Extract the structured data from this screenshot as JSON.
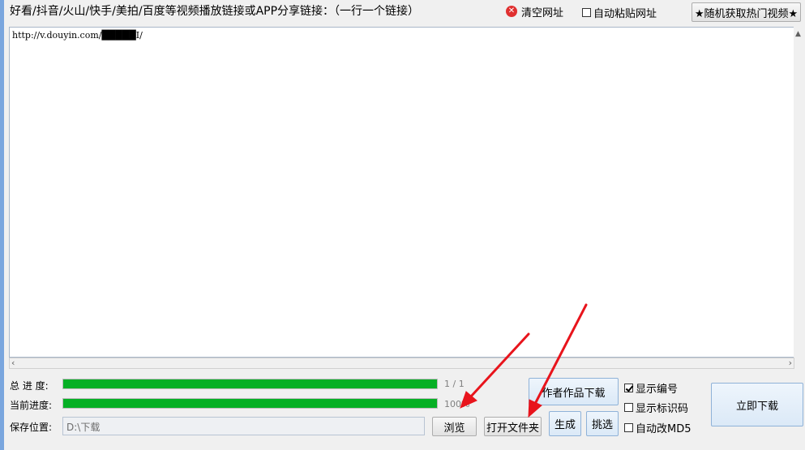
{
  "header": {
    "title": "好看/抖音/火山/快手/美拍/百度等视频播放链接或APP分享链接：（一行一个链接）",
    "clear_label": "清空网址",
    "auto_paste_label": "自动粘贴网址",
    "auto_paste_checked": false,
    "hot_video_label": "★随机获取热门视频★"
  },
  "url_box": {
    "text": "http://v.douyin.com/█████I/"
  },
  "progress": {
    "total_label": "总 进 度:",
    "total_value": "1 / 1",
    "total_fraction": 1.0,
    "current_label": "当前进度:",
    "current_value": "100%",
    "current_fraction": 1.0
  },
  "save": {
    "label": "保存位置:",
    "path": "D:\\下载",
    "browse_label": "浏览",
    "open_folder_label": "打开文件夹"
  },
  "actions": {
    "author_download_label": "作者作品下载",
    "generate_label": "生成",
    "pick_label": "挑选",
    "download_now_label": "立即下载"
  },
  "options": {
    "show_number_label": "显示编号",
    "show_number_checked": true,
    "show_watermark_label": "显示标识码",
    "show_watermark_checked": false,
    "auto_md5_label": "自动改MD5",
    "auto_md5_checked": false
  },
  "colors": {
    "progress_fill": "#06b025",
    "annotation_arrow": "#e8141c",
    "clear_icon": "#e03030"
  },
  "icons": [
    "clear-x-icon",
    "checkbox-icon",
    "scroll-arrow-icon"
  ]
}
